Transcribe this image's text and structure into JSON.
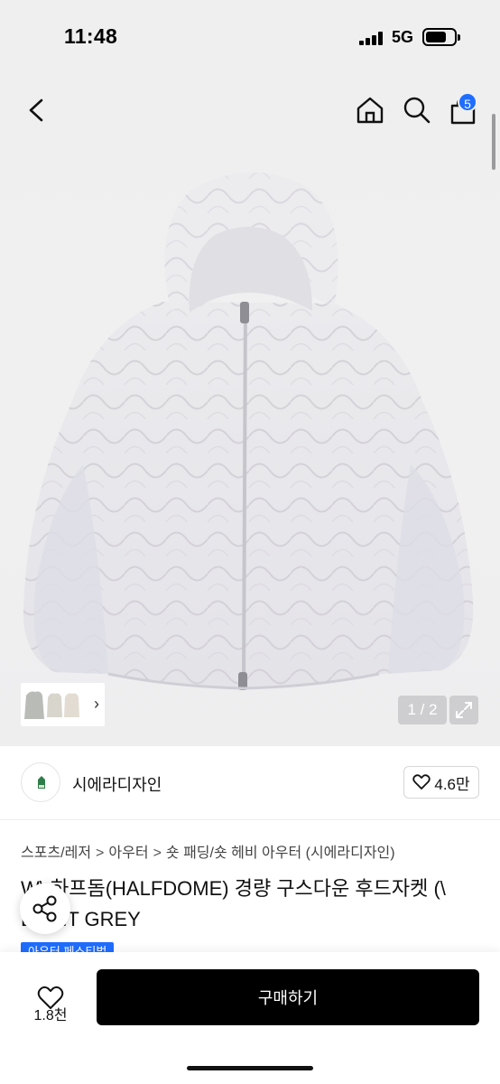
{
  "status_bar": {
    "time": "11:48",
    "network": "5G",
    "icons": [
      "signal-icon",
      "battery-icon"
    ]
  },
  "nav": {
    "icons": [
      "chevron-left-icon",
      "home-icon",
      "search-icon",
      "cart-icon"
    ],
    "cart_badge": "5"
  },
  "gallery": {
    "counter": "1 / 2",
    "thumbnail_chevron": "›",
    "icons": [
      "expand-icon"
    ]
  },
  "brand": {
    "name": "시에라디자인",
    "likes": "4.6만",
    "icons": [
      "heart-outline-icon"
    ]
  },
  "product": {
    "breadcrumb": [
      "스포츠/레저",
      "아우터",
      "숏 패딩/숏 헤비 아우터 (시에라디자인)"
    ],
    "breadcrumb_separator": ">",
    "title": "W\\ 하프돔(HALFDOME) 경량 구스다운 후드자켓 (\\ LIGHT GREY",
    "promo_tag": "아우터 페스티벌"
  },
  "bottom_bar": {
    "wish_count": "1.8천",
    "buy_label": "구매하기",
    "icons": [
      "heart-outline-icon",
      "share-icon"
    ]
  },
  "colors": {
    "accent": "#1f6dff",
    "buy_button": "#000000",
    "hero_background": "#efeff0",
    "jacket": "#e6e6ea"
  }
}
